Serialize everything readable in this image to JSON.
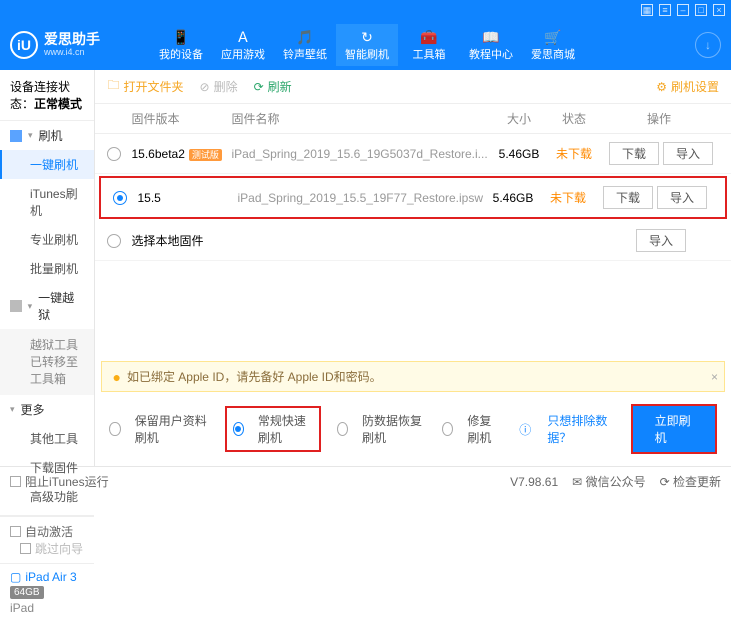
{
  "brand": {
    "name": "爱思助手",
    "url": "www.i4.cn",
    "logo": "iU"
  },
  "nav": {
    "items": [
      {
        "label": "我的设备"
      },
      {
        "label": "应用游戏"
      },
      {
        "label": "铃声壁纸"
      },
      {
        "label": "智能刷机",
        "active": true
      },
      {
        "label": "工具箱"
      },
      {
        "label": "教程中心"
      },
      {
        "label": "爱思商城"
      }
    ]
  },
  "sidebar": {
    "status_label": "设备连接状态：",
    "status_value": "正常模式",
    "sections": [
      {
        "title": "刷机",
        "items": [
          "一键刷机",
          "iTunes刷机",
          "专业刷机",
          "批量刷机"
        ],
        "active": 0
      },
      {
        "title": "一键越狱",
        "notice": "越狱工具已转移至\n工具箱"
      },
      {
        "title": "更多",
        "items": [
          "其他工具",
          "下载固件",
          "高级功能"
        ]
      }
    ],
    "auto_activate": "自动激活",
    "skip_guide": "跳过向导",
    "device": {
      "name": "iPad Air 3",
      "storage": "64GB",
      "type": "iPad"
    }
  },
  "toolbar": {
    "open": "打开文件夹",
    "delete": "删除",
    "refresh": "刷新",
    "settings": "刷机设置"
  },
  "columns": {
    "version": "固件版本",
    "name": "固件名称",
    "size": "大小",
    "status": "状态",
    "ops": "操作"
  },
  "rows": [
    {
      "version": "15.6beta2",
      "tag": "测试版",
      "name": "iPad_Spring_2019_15.6_19G5037d_Restore.i...",
      "size": "5.46GB",
      "status": "未下载",
      "selected": false,
      "highlight": false
    },
    {
      "version": "15.5",
      "tag": "",
      "name": "iPad_Spring_2019_15.5_19F77_Restore.ipsw",
      "size": "5.46GB",
      "status": "未下载",
      "selected": true,
      "highlight": true
    }
  ],
  "local_row": "选择本地固件",
  "ops": {
    "download": "下载",
    "import": "导入"
  },
  "warning": "如已绑定 Apple ID，请先备好 Apple ID和密码。",
  "modes": {
    "m1": "保留用户资料刷机",
    "m2": "常规快速刷机",
    "m3": "防数据恢复刷机",
    "m4": "修复刷机",
    "link": "只想排除数据？",
    "go": "立即刷机"
  },
  "footer": {
    "block": "阻止iTunes运行",
    "version": "V7.98.61",
    "wechat": "微信公众号",
    "update": "检查更新"
  }
}
